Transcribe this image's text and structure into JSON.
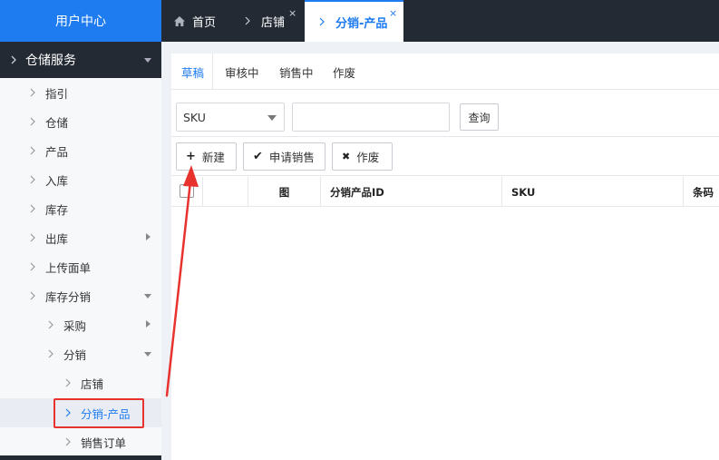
{
  "sidebar": {
    "title": "用户中心",
    "group": "仓储服务",
    "items": [
      {
        "label": "指引"
      },
      {
        "label": "仓储"
      },
      {
        "label": "产品"
      },
      {
        "label": "入库"
      },
      {
        "label": "库存"
      },
      {
        "label": "出库"
      },
      {
        "label": "上传面单"
      },
      {
        "label": "库存分销"
      },
      {
        "label": "采购"
      },
      {
        "label": "分销"
      },
      {
        "label": "店铺"
      },
      {
        "label": "分销-产品"
      },
      {
        "label": "销售订单"
      }
    ]
  },
  "tabs": [
    {
      "label": "首页",
      "icon": "home-icon"
    },
    {
      "label": "店铺",
      "close": "×"
    },
    {
      "label": "分销-产品",
      "close": "×",
      "active": true
    }
  ],
  "status_tabs": [
    {
      "label": "草稿",
      "active": true
    },
    {
      "label": "审核中"
    },
    {
      "label": "销售中"
    },
    {
      "label": "作废"
    }
  ],
  "search": {
    "field": "SKU",
    "value": "",
    "query_label": "查询"
  },
  "actions": {
    "new": {
      "icon": "+",
      "label": "新建"
    },
    "apply": {
      "icon": "✔",
      "label": "申请销售"
    },
    "void": {
      "icon": "✖",
      "label": "作废"
    }
  },
  "table": {
    "columns": [
      "图",
      "分销产品ID",
      "SKU",
      "条码"
    ]
  },
  "colors": {
    "brand_blue": "#1e7cf0",
    "dark_bar": "#232a34",
    "annotation_red": "#e8322e"
  }
}
